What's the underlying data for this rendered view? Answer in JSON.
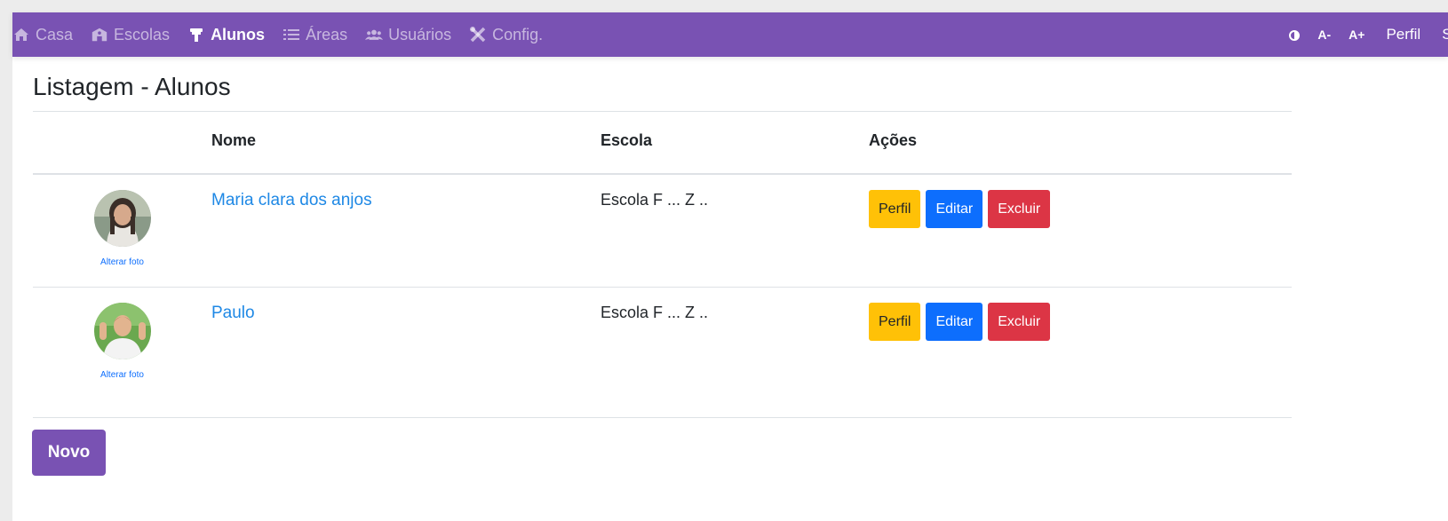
{
  "nav": {
    "items": [
      {
        "label": "Casa",
        "icon": "home-icon",
        "active": false
      },
      {
        "label": "Escolas",
        "icon": "school-icon",
        "active": false
      },
      {
        "label": "Alunos",
        "icon": "student-icon",
        "active": true
      },
      {
        "label": "Áreas",
        "icon": "list-icon",
        "active": false
      },
      {
        "label": "Usuários",
        "icon": "users-icon",
        "active": false
      },
      {
        "label": "Config.",
        "icon": "tools-icon",
        "active": false
      }
    ],
    "contrast_icon": "contrast-icon",
    "font_decrease": "A-",
    "font_increase": "A+",
    "profile": "Perfil",
    "logout": "Sa"
  },
  "page": {
    "title": "Listagem - Alunos"
  },
  "table": {
    "headers": {
      "photo": "",
      "name": "Nome",
      "school": "Escola",
      "actions": "Ações"
    },
    "rows": [
      {
        "name": "Maria clara dos anjos",
        "school": "Escola F ... Z ..",
        "photo_link": "Alterar foto"
      },
      {
        "name": "Paulo",
        "school": "Escola F ... Z ..",
        "photo_link": "Alterar foto"
      }
    ],
    "actions": {
      "profile": "Perfil",
      "edit": "Editar",
      "delete": "Excluir"
    }
  },
  "new_button": "Novo",
  "colors": {
    "brand": "#7952b3",
    "warning": "#ffc107",
    "primary": "#0d6efd",
    "danger": "#dc3545",
    "link": "#1e88e5"
  }
}
